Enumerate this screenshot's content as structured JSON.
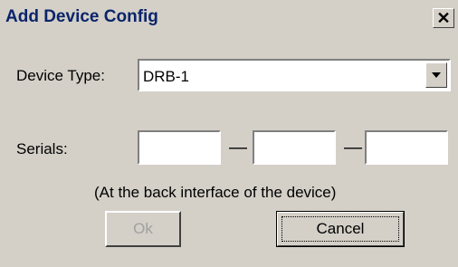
{
  "window": {
    "title": "Add Device Config"
  },
  "device_type": {
    "label": "Device Type:",
    "value": "DRB-1"
  },
  "serials": {
    "label": "Serials:",
    "fields": [
      "",
      "",
      ""
    ],
    "separator": "—",
    "hint": "(At the back interface of the device)"
  },
  "buttons": {
    "ok": "Ok",
    "cancel": "Cancel"
  },
  "icons": {
    "close": "close-icon",
    "dropdown": "chevron-down-icon"
  }
}
